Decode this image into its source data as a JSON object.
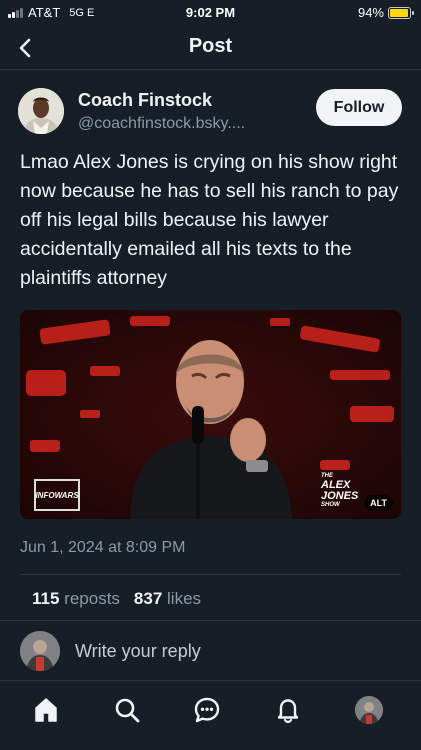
{
  "status_bar": {
    "carrier": "AT&T",
    "network": "5G E",
    "time": "9:02 PM",
    "battery_percent_label": "94%",
    "battery_level": 0.94
  },
  "header": {
    "title": "Post"
  },
  "post": {
    "author_name": "Coach Finstock",
    "author_handle": "@coachfinstock.bsky....",
    "follow_label": "Follow",
    "text": "Lmao Alex Jones is crying on his show right now because he has to sell his ranch to pay off his legal bills because his lawyer accidentally emailed all his texts to the plaintiffs attorney",
    "media": {
      "alt_badge": "ALT",
      "logo_left": "INFOWARS",
      "logo_right_small": "THE",
      "logo_right": "ALEX JONES",
      "logo_right_sub": "SHOW"
    },
    "timestamp": "Jun 1, 2024 at 8:09 PM",
    "reposts_count": "115",
    "reposts_label": "reposts",
    "likes_count": "837",
    "likes_label": "likes"
  },
  "reply": {
    "placeholder": "Write your reply"
  },
  "tabbar": {
    "items": [
      "home",
      "search",
      "chat",
      "notifications",
      "profile"
    ]
  }
}
